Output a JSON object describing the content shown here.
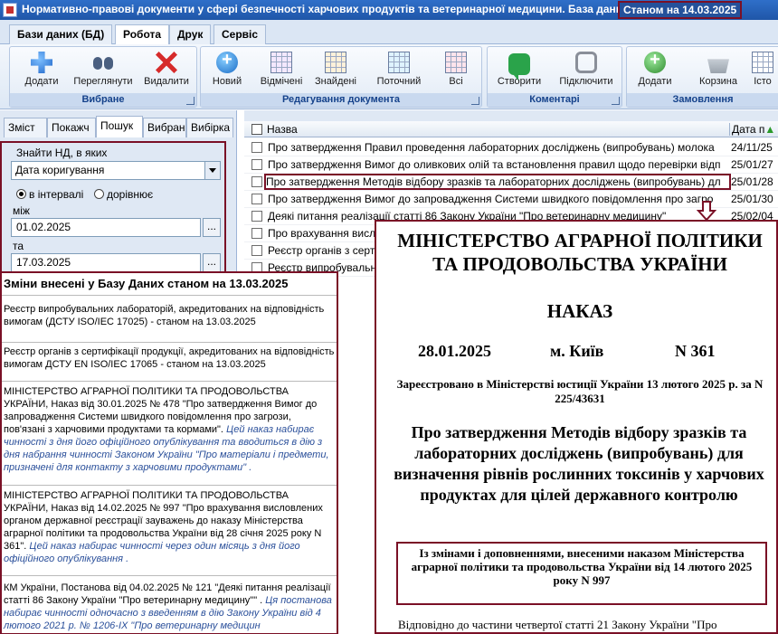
{
  "window": {
    "title": "Нормативно-правові документи у сфері безпечності харчових продуктів та ветеринарної медицини. База даних",
    "status": "Станом на 14.03.2025"
  },
  "menu_tabs": [
    "Бази даних (БД)",
    "Робота",
    "Друк",
    "Сервіс"
  ],
  "ribbon": {
    "groups": [
      {
        "title": "Вибране",
        "buttons": [
          "Додати",
          "Переглянути",
          "Видалити"
        ]
      },
      {
        "title": "Редагування документа",
        "buttons": [
          "Новий",
          "Відмічені",
          "Знайдені",
          "Поточний",
          "Всі"
        ]
      },
      {
        "title": "Коментарі",
        "buttons": [
          "Створити",
          "Підключити"
        ]
      },
      {
        "title": "Замовлення",
        "buttons": [
          "Додати",
          "Корзина",
          "Істо"
        ]
      }
    ]
  },
  "left_tabs": [
    "Зміст",
    "Покажч",
    "Пошук",
    "Вибрані",
    "Вибірка"
  ],
  "search": {
    "label": "Знайти НД, в яких",
    "field": "Дата коригування",
    "radio_interval": "в інтервалі",
    "radio_equal": "дорівнює",
    "between_label": "між",
    "date_from": "01.02.2025",
    "and_label": "та",
    "date_to": "17.03.2025",
    "browse": "..."
  },
  "list": {
    "col_name": "Назва",
    "col_date": "Дата п",
    "rows": [
      {
        "name": "Про затвердження Правил проведення лабораторних досліджень (випробувань) молока",
        "date": "24/11/25"
      },
      {
        "name": "Про затвердження Вимог до оливкових олій та встановлення правил щодо перевірки відп",
        "date": "25/01/27"
      },
      {
        "name": "Про затвердження Методів відбору зразків та лабораторних досліджень (випробувань) дл",
        "date": "25/01/28"
      },
      {
        "name": "Про затвердження Вимог до запровадження Системи швидкого повідомлення про загро",
        "date": "25/01/30"
      },
      {
        "name": "Деякі питання реалізації статті 86 Закону України \"Про ветеринарну медицину\"",
        "date": "25/02/04"
      },
      {
        "name": "Про врахування висл",
        "date": ""
      },
      {
        "name": "Реєстр органів з серт",
        "date": ""
      },
      {
        "name": "Реєстр випробувальн",
        "date": ""
      }
    ]
  },
  "changes": {
    "title": "Зміни внесені у Базу Даних  станом  на 13.03.2025",
    "entries": [
      {
        "text": "Реєстр випробувальних лабораторій, акредитованих на відповідність вимогам (ДСТУ ISO/IEC 17025)  - станом на 13.03.2025",
        "note": ""
      },
      {
        "text": "Реєстр органів  з сертифікації продукції, акредитованих на відповідність вимогам ДСТУ EN ISO/IEC 17065 - станом  на 13.03.2025",
        "note": ""
      },
      {
        "text": "МІНІСТЕРСТВО АГРАРНОЇ ПОЛІТИКИ ТА ПРОДОВОЛЬСТВА УКРАЇНИ, Наказ від 30.01.2025 № 478  \"Про затвердження Вимог до запровадження Системи швидкого повідомлення про загрози, пов'язані з харчовими продуктами та кормами\".",
        "note": "Цей наказ набирає чинності з дня його офіційного  опублікування та вводиться в дію з дня набрання  чинності Законом України \"Про матеріали і предмети, призначені для контакту з харчовими продуктами\" ."
      },
      {
        "text": "МІНІСТЕРСТВО АГРАРНОЇ ПОЛІТИКИ ТА ПРОДОВОЛЬСТВА УКРАЇНИ, Наказ від 14.02.2025 № 997  \"Про врахування  висловлених органом державної реєстрації зауважень до наказу Міністерства аграрної політики та продовольства України від 28 січня 2025 року N 361\".",
        "note": "Цей наказ набирає  чинності через один місяць з дня його офіційного опублікування ."
      },
      {
        "text": "КМ України, Постанова  від 04.02.2025 № 121  \"Деякі питання реалізації статті 86 Закону України \"Про ветеринарну медицину\"\" .",
        "note": "Ця постанова набирає чинності одночасно з введенням в дію Закону України від 4 лютого 2021 р. № 1206-IX \"Про ветеринарну медицин"
      }
    ]
  },
  "document": {
    "ministry": "МІНІСТЕРСТВО АГРАРНОЇ ПОЛІТИКИ ТА ПРОДОВОЛЬСТВА УКРАЇНИ",
    "order": "НАКАЗ",
    "date": "28.01.2025",
    "city": "м. Київ",
    "number": "N 361",
    "registered": "Зареєстровано в Міністерстві юстиції України 13 лютого 2025 р. за N 225/43631",
    "title": "Про затвердження Методів відбору зразків та лабораторних досліджень (випробувань) для визначення рівнів рослинних токсинів у харчових продуктах для цілей державного контролю",
    "amendments": "Із змінами і доповненнями, внесеними наказом Міністерства аграрної політики та продовольства України від 14 лютого 2025 року N 997",
    "body_start": "Відповідно до частини четвертої статті 21 Закону України \"Про"
  }
}
